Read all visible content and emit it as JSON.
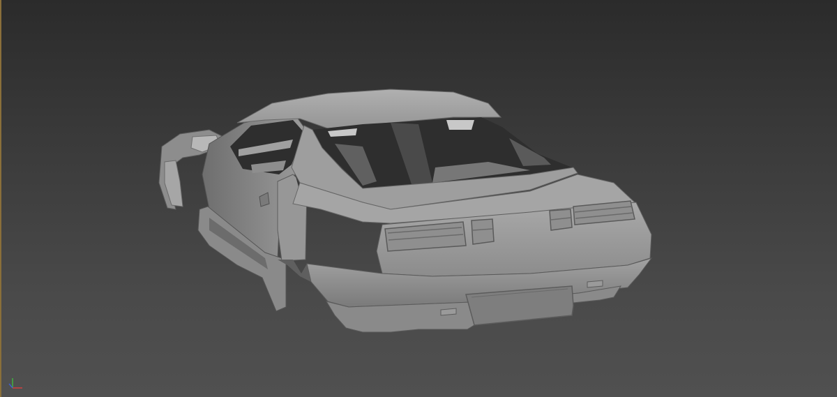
{
  "viewport": {
    "background_top": "#2b2b2b",
    "background_bottom": "#505050",
    "edge_accent": "#8a6f3a"
  },
  "model": {
    "icon": "car-body-shell",
    "shade_base": "#9a9a9a",
    "shade_light": "#b4b4b4",
    "shade_dark": "#5f5f5f",
    "interior": "#2e2e2e"
  },
  "axis_gizmo": {
    "x_color": "#d04040",
    "y_color": "#40b040",
    "z_color": "#4060d0"
  }
}
